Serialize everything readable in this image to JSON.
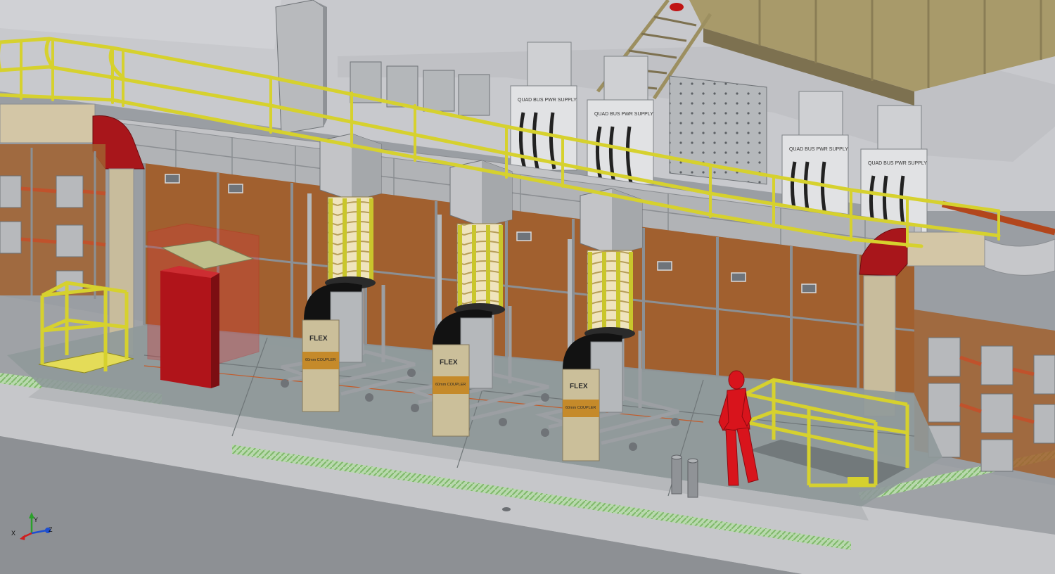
{
  "scene": {
    "units": [
      {
        "flex_label": "FLEX",
        "coupler_label": "60mm COUPLER"
      },
      {
        "flex_label": "FLEX",
        "coupler_label": "60mm COUPLER"
      },
      {
        "flex_label": "FLEX",
        "coupler_label": "60mm COUPLER"
      }
    ],
    "power_supplies": [
      "QUAD BUS PWR SUPPLY",
      "QUAD BUS PWR SUPPLY",
      "QUAD BUS PWR SUPPLY",
      "QUAD BUS PWR SUPPLY"
    ]
  },
  "axis_triad": {
    "x_label": "X",
    "y_label": "Y",
    "z_label": "Z"
  },
  "colors": {
    "floor": "#a4a7ab",
    "upper_floor": "#c9cace",
    "wall_panel": "#a1602f",
    "frame_grey": "#8c9094",
    "railing": "#d6d12e",
    "red_equipment": "#b0141a",
    "human_figure": "#d8141c",
    "coil_cream": "#e8dcb0",
    "pedestal": "#cbbf9a",
    "green_stripe": "#9ccc86"
  }
}
